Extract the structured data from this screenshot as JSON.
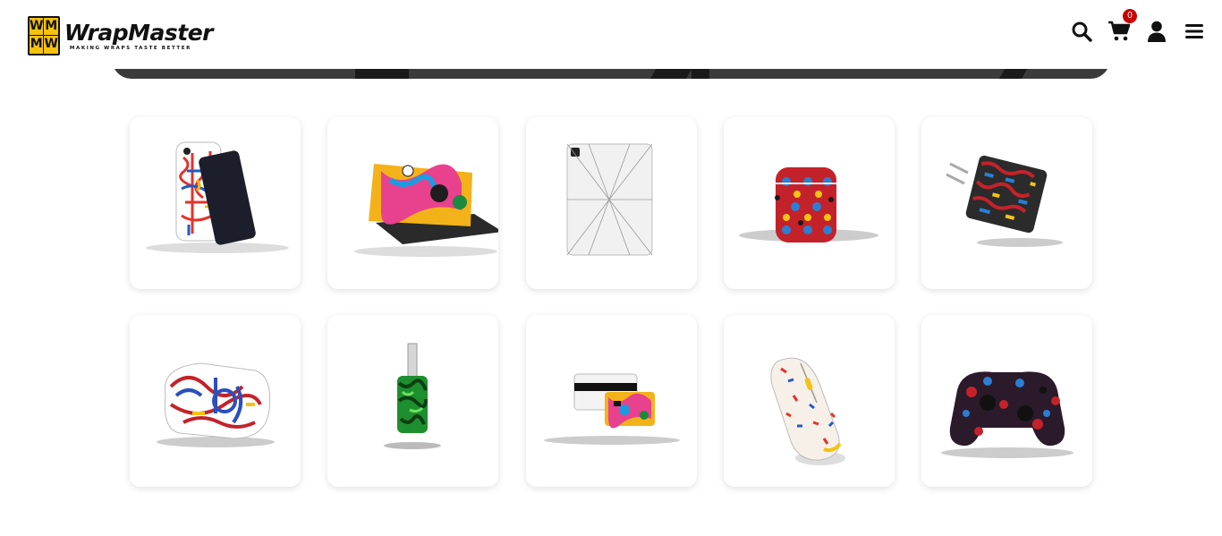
{
  "brand": {
    "mark_letters": [
      "W",
      "M",
      "M",
      "W"
    ],
    "name": "WrapMaster",
    "tagline": "MAKING WRAPS TASTE BETTER",
    "colors": {
      "yellow": "#f6c20f",
      "black": "#111111"
    }
  },
  "nav": {
    "icons": [
      "search-icon",
      "cart-icon",
      "user-icon",
      "menu-icon"
    ],
    "cart_count": "0",
    "badge_color": "#c80000"
  },
  "categories": [
    {
      "icon": "phone-skin-icon"
    },
    {
      "icon": "laptop-skin-icon"
    },
    {
      "icon": "tablet-skin-icon"
    },
    {
      "icon": "earbuds-case-skin-icon"
    },
    {
      "icon": "charger-skin-icon"
    },
    {
      "icon": "pouch-skin-icon"
    },
    {
      "icon": "usb-drive-skin-icon"
    },
    {
      "icon": "card-skin-icon"
    },
    {
      "icon": "mouse-skin-icon"
    },
    {
      "icon": "gamepad-skin-icon"
    }
  ]
}
